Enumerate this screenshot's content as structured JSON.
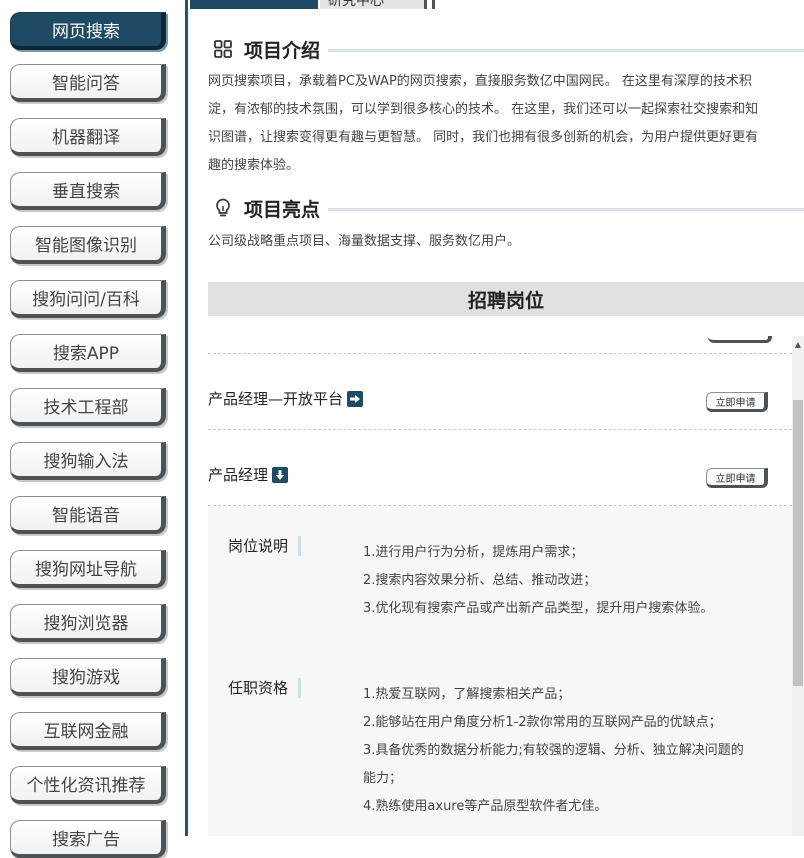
{
  "sidebar": {
    "items": [
      {
        "label": "网页搜索",
        "active": true
      },
      {
        "label": "智能问答"
      },
      {
        "label": "机器翻译"
      },
      {
        "label": "垂直搜索"
      },
      {
        "label": "智能图像识别"
      },
      {
        "label": "搜狗问问/百科"
      },
      {
        "label": "搜索APP"
      },
      {
        "label": "技术工程部"
      },
      {
        "label": "搜狗输入法"
      },
      {
        "label": "智能语音"
      },
      {
        "label": "搜狗网址导航"
      },
      {
        "label": "搜狗浏览器"
      },
      {
        "label": "搜狗游戏"
      },
      {
        "label": "互联网金融"
      },
      {
        "label": "个性化资讯推荐"
      },
      {
        "label": "搜索广告"
      }
    ]
  },
  "top_tabs": {
    "second_tab_label": "研究中心"
  },
  "intro": {
    "icon": "grid-icon",
    "title": "项目介绍",
    "lines": [
      "网页搜索项目，承载着PC及WAP的网页搜索，直接服务数亿中国网民。 在这里有深厚的技术积",
      "淀，有浓郁的技术氛围，可以学到很多核心的技术。 在这里，我们还可以一起探索社交搜索和知",
      "识图谱，让搜索变得更有趣与更智慧。 同时，我们也拥有很多创新的机会，为用户提供更好更有",
      "趣的搜索体验。"
    ]
  },
  "highlights": {
    "icon": "lightbulb-icon",
    "title": "项目亮点",
    "text": "公司级战略重点项目、海量数据支撑、服务数亿用户。"
  },
  "recruit": {
    "title": "招聘岗位",
    "apply_label": "立即申请",
    "jobs": [
      {
        "title": "产品经理—开放平台",
        "icon": "arrow-right-icon"
      },
      {
        "title": "产品经理",
        "icon": "arrow-down-icon"
      }
    ],
    "details": {
      "desc_label": "岗位说明",
      "desc_lines": [
        "1.进行用户行为分析，提炼用户需求；",
        "2.搜索内容效果分析、总结、推动改进；",
        "3.优化现有搜索产品或产出新产品类型，提升用户搜索体验。"
      ],
      "req_label": "任职资格",
      "req_lines": [
        "1.热爱互联网，了解搜索相关产品；",
        "2.能够站在用户角度分析1-2款你常用的互联网产品的优缺点；",
        "3.具备优秀的数据分析能力;有较强的逻辑、分析、独立解决问题的",
        "能力；",
        "4.熟练使用axure等产品原型软件者尤佳。"
      ]
    }
  },
  "colors": {
    "accent": "#1e4b63",
    "bar": "#e1e1e1"
  }
}
